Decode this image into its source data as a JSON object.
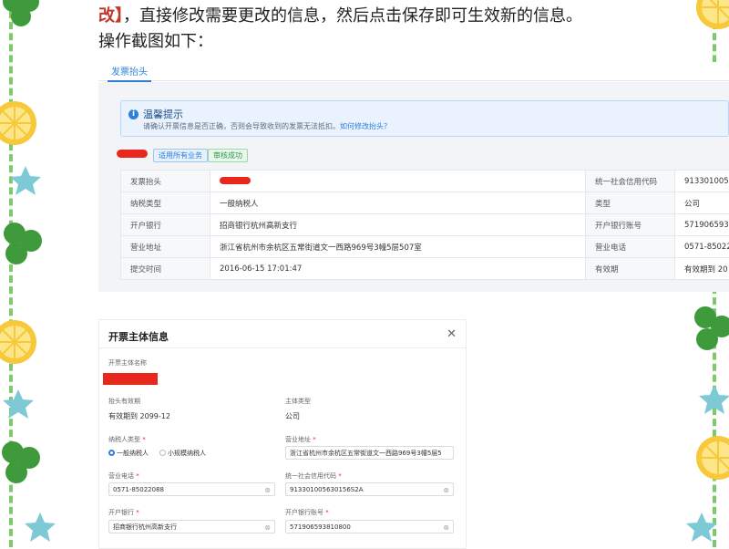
{
  "intro": {
    "accent_text": "改】",
    "line1_rest": "，直接修改需要更改的信息，然后点击保存即可生效新的信息。",
    "line2": "操作截图如下："
  },
  "invoice_panel": {
    "tab_label": "发票抬头",
    "notice": {
      "title": "温馨提示",
      "text": "请确认开票信息是否正确，否则会导致收到的发票无法抵扣。",
      "link": "如何修改抬头?"
    },
    "badges": [
      "适用所有业务",
      "审核成功"
    ],
    "rows": [
      {
        "k1": "发票抬头",
        "v1": "",
        "k2": "统一社会信用代码",
        "v2": "91330100563"
      },
      {
        "k1": "纳税类型",
        "v1": "一般纳税人",
        "k2": "类型",
        "v2": "公司"
      },
      {
        "k1": "开户银行",
        "v1": "招商银行杭州高新支行",
        "k2": "开户银行账号",
        "v2": "571906593"
      },
      {
        "k1": "营业地址",
        "v1": "浙江省杭州市余杭区五常街道文一西路969号3幢5层507室",
        "k2": "营业电话",
        "v2": "0571-850220"
      },
      {
        "k1": "提交时间",
        "v1": "2016-06-15 17:01:47",
        "k2": "有效期",
        "v2": "有效期到 20"
      }
    ]
  },
  "dialog": {
    "title": "开票主体信息",
    "fields": {
      "subject_name_label": "开票主体名称",
      "validity_label": "抬头有效期",
      "validity_value": "有效期到 2099-12",
      "subject_type_label": "主体类型",
      "subject_type_value": "公司",
      "taxpayer_type_label": "纳税人类型",
      "taxpayer_options": [
        "一般纳税人",
        "小规模纳税人"
      ],
      "address_label": "营业地址",
      "address_value": "浙江省杭州市余杭区五常街道文一西路969号3幢5层5",
      "phone_label": "营业电话",
      "phone_value": "0571-85022088",
      "credit_code_label": "统一社会信用代码",
      "credit_code_value": "913301005630156S2A",
      "bank_label": "开户银行",
      "bank_value": "招商银行杭州高新支行",
      "bank_account_label": "开户银行账号",
      "bank_account_value": "571906593810800"
    }
  },
  "colors": {
    "accent": "#2f7ed8",
    "redaction": "#e8281c",
    "intro_accent": "#c0392b"
  }
}
